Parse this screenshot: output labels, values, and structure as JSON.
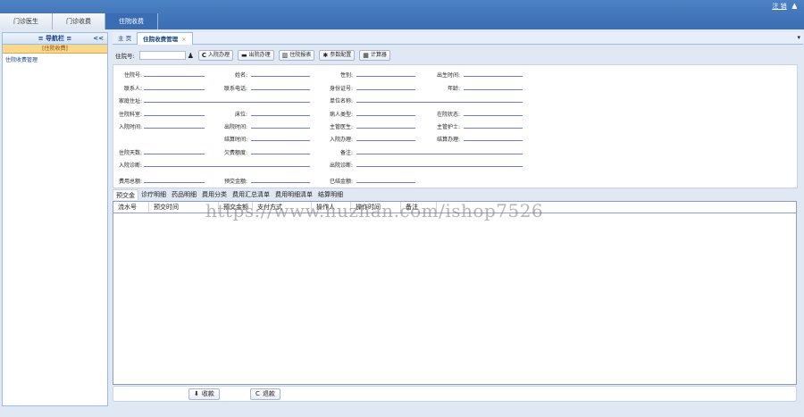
{
  "top": {
    "tabs": [
      {
        "label": "门诊医生"
      },
      {
        "label": "门诊收费"
      },
      {
        "label": "住院收费"
      }
    ],
    "links": [
      "注 销",
      "▲"
    ]
  },
  "nav": {
    "title": "≡ 导航栏 ≡",
    "collapse": "<<",
    "group": "[住院收费]",
    "items": [
      "住院收费管理"
    ]
  },
  "tabs": [
    {
      "label": "主 页"
    },
    {
      "label": "住院收费管理"
    }
  ],
  "tab_close": "×",
  "tab_menu": "▾",
  "toolbar": {
    "zyh_label": "住院号:",
    "buttons": [
      {
        "icon": "C",
        "label": "入院办理"
      },
      {
        "icon": "▬",
        "label": "出院办理"
      },
      {
        "icon": "▥",
        "label": "住院报表"
      },
      {
        "icon": "✱",
        "label": "参数配置"
      },
      {
        "icon": "▦",
        "label": "计算器"
      }
    ]
  },
  "form": {
    "labels": [
      "住院号:",
      "姓名:",
      "性别:",
      "出生时间:",
      "联系人:",
      "联系电话:",
      "身份证号:",
      "年龄:",
      "家庭住址:",
      "单位名称:",
      "住院科室:",
      "床位:",
      "病人类型:",
      "在院状态:",
      "入院时间:",
      "出院时间:",
      "主管医生:",
      "主管护士:",
      "结算时间:",
      "入院办理:",
      "结算办理:",
      "住院天数:",
      "欠费额度:",
      "备注:",
      "入院诊断:",
      "出院诊断:",
      "费用总额:",
      "预交金额:",
      "已结金额:"
    ]
  },
  "detail_tabs": [
    "预交金",
    "诊疗明细",
    "药品明细",
    "费用分类",
    "费用汇总清单",
    "费用明细清单",
    "结算明细"
  ],
  "grid": {
    "columns": [
      "流水号",
      "预交时间",
      "预交金额",
      "支付方式",
      "操作人",
      "操作时间",
      "备注"
    ]
  },
  "watermark": "https://www.huzhan.com/ishop7526",
  "bottom": {
    "buttons": [
      {
        "icon": "⬇",
        "label": "收款"
      },
      {
        "icon": "C",
        "label": "退款"
      }
    ]
  }
}
